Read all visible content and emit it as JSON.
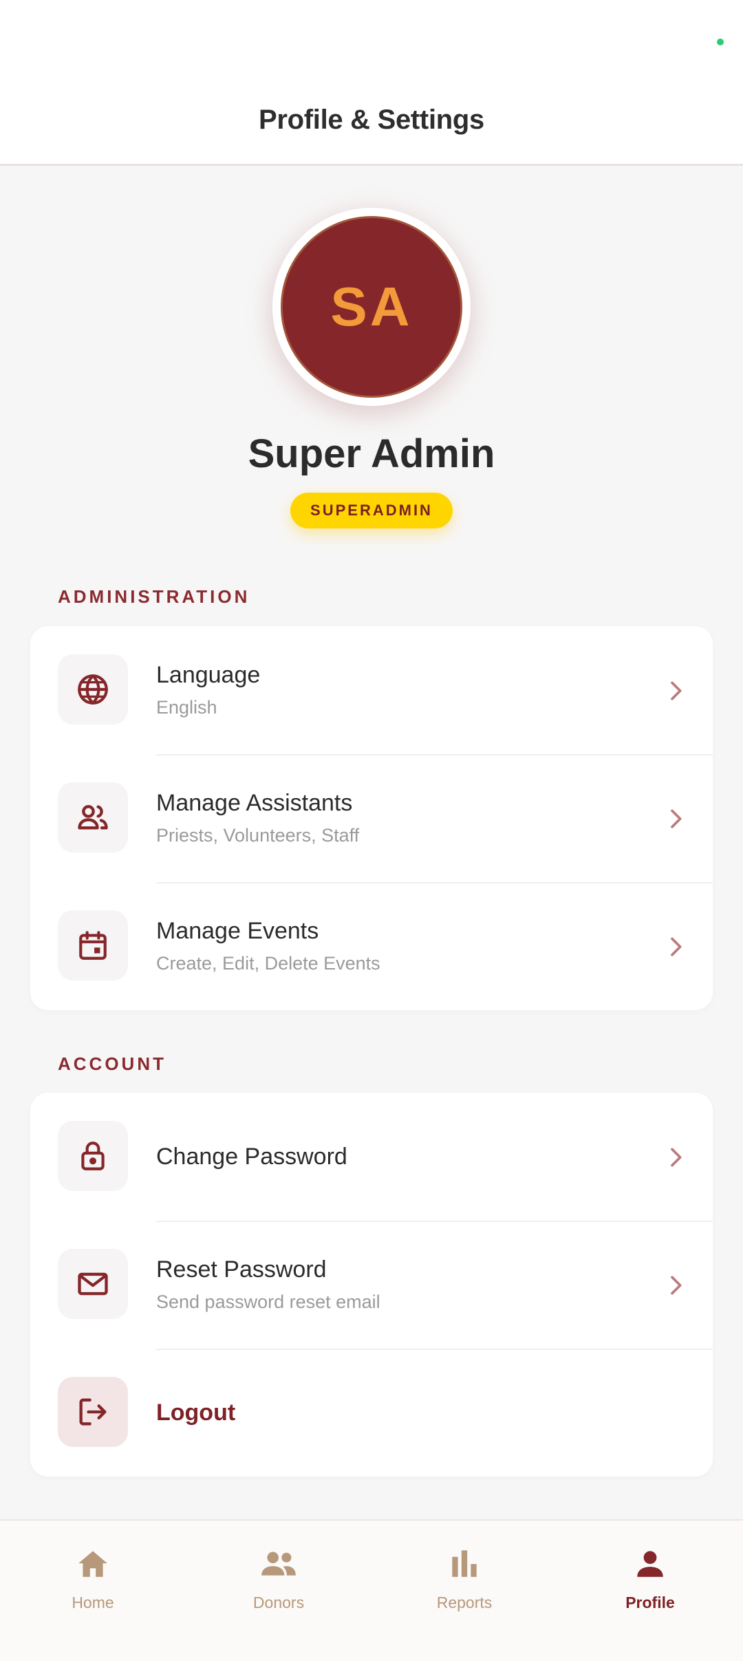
{
  "header": {
    "title": "Profile & Settings"
  },
  "profile": {
    "initials": "SA",
    "name": "Super Admin",
    "role": "SUPERADMIN"
  },
  "sections": {
    "administration": {
      "title": "ADMINISTRATION",
      "items": [
        {
          "title": "Language",
          "subtitle": "English",
          "icon": "globe-icon"
        },
        {
          "title": "Manage Assistants",
          "subtitle": "Priests, Volunteers, Staff",
          "icon": "people-icon"
        },
        {
          "title": "Manage Events",
          "subtitle": "Create, Edit, Delete Events",
          "icon": "calendar-icon"
        }
      ]
    },
    "account": {
      "title": "ACCOUNT",
      "items": [
        {
          "title": "Change Password",
          "icon": "lock-icon"
        },
        {
          "title": "Reset Password",
          "subtitle": "Send password reset email",
          "icon": "mail-icon"
        },
        {
          "title": "Logout",
          "icon": "logout-icon"
        }
      ]
    }
  },
  "nav": {
    "items": [
      {
        "label": "Home",
        "icon": "home-icon"
      },
      {
        "label": "Donors",
        "icon": "people-icon"
      },
      {
        "label": "Reports",
        "icon": "bar-chart-icon"
      },
      {
        "label": "Profile",
        "icon": "person-icon",
        "active": true
      }
    ]
  },
  "colors": {
    "primary": "#84262a",
    "accent": "#f39a3a",
    "badge": "#ffd500",
    "nav_inactive": "#b7987a"
  }
}
